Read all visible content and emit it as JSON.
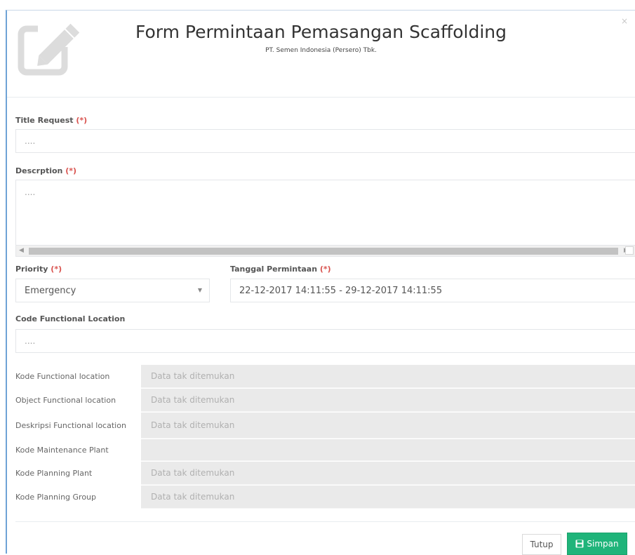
{
  "header": {
    "title": "Form Permintaan Pemasangan Scaffolding",
    "subtitle": "PT. Semen Indonesia (Persero) Tbk.",
    "close_label": "×",
    "logo_icon": "edit-icon"
  },
  "form": {
    "required_mark": "(*)",
    "title_request": {
      "label": "Title Request",
      "placeholder": "...."
    },
    "description": {
      "label": "Descrption",
      "placeholder": "...."
    },
    "priority": {
      "label": "Priority",
      "value": "Emergency",
      "caret": "▼"
    },
    "tanggal": {
      "label": "Tanggal Permintaan",
      "value": "22-12-2017 14:11:55 - 29-12-2017 14:11:55"
    },
    "code_location": {
      "label": "Code Functional Location",
      "placeholder": "...."
    }
  },
  "info_rows": [
    {
      "label": "Kode Functional location",
      "value": "Data tak ditemukan"
    },
    {
      "label": "Object Functional location",
      "value": "Data tak ditemukan"
    },
    {
      "label": "Deskripsi Functional location",
      "value": "Data tak ditemukan"
    },
    {
      "label": "Kode Maintenance Plant",
      "value": ""
    },
    {
      "label": "Kode Planning Plant",
      "value": "Data tak ditemukan"
    },
    {
      "label": "Kode Planning Group",
      "value": "Data tak ditemukan"
    }
  ],
  "footer": {
    "tutup_label": "Tutup",
    "simpan_label": "Simpan",
    "simpan_icon": "save-icon"
  },
  "colors": {
    "accent_border": "#6fa3d6",
    "required": "#d9534f",
    "save_button": "#1fb47a"
  }
}
